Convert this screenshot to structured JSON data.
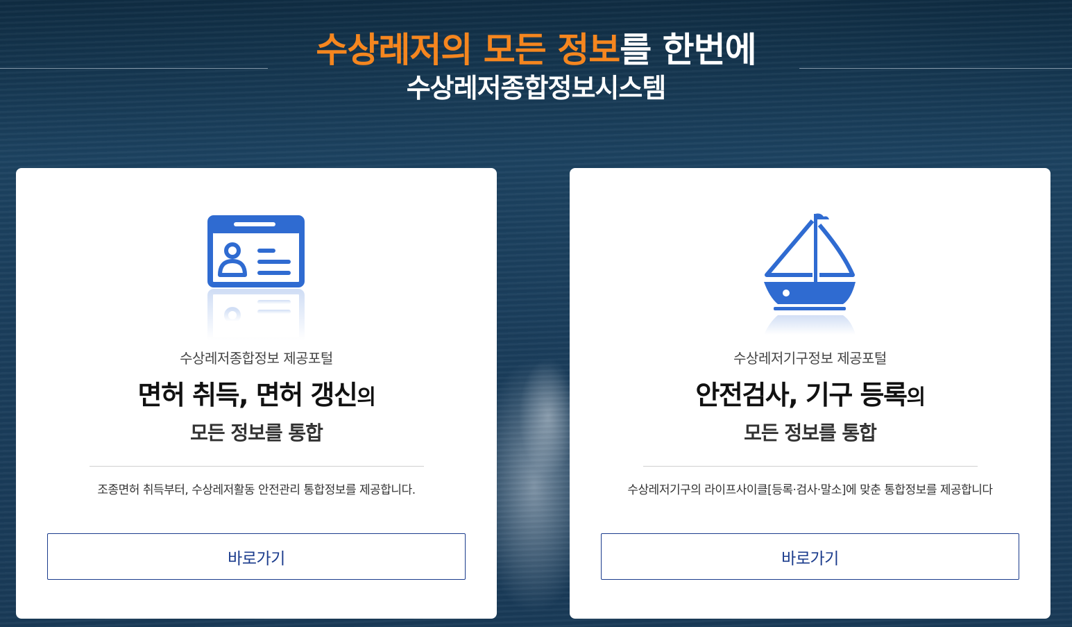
{
  "hero": {
    "title_accent": "수상레저의 모든 정보",
    "title_rest": "를 한번에",
    "subtitle": "수상레저종합정보시스템",
    "accent_color": "#f5861f"
  },
  "cards": [
    {
      "icon": "id-card-icon",
      "label": "수상레저종합정보 제공포털",
      "headline": "면허 취득, 면허 갱신",
      "headline_suffix": "의",
      "subhead": "모든 정보를 통합",
      "description": "조종면허 취득부터, 수상레저활동 안전관리 통합정보를 제공합니다.",
      "button_label": "바로가기"
    },
    {
      "icon": "sailboat-icon",
      "label": "수상레저기구정보 제공포털",
      "headline": "안전검사, 기구 등록",
      "headline_suffix": "의",
      "subhead": "모든 정보를 통합",
      "description": "수상레저기구의 라이프사이클[등록·검사·말소]에 맞춘 통합정보를 제공합니다",
      "button_label": "바로가기"
    }
  ],
  "colors": {
    "icon_blue": "#2f6bd1",
    "button_border": "#1a3b8c",
    "card_bg": "#ffffff"
  }
}
